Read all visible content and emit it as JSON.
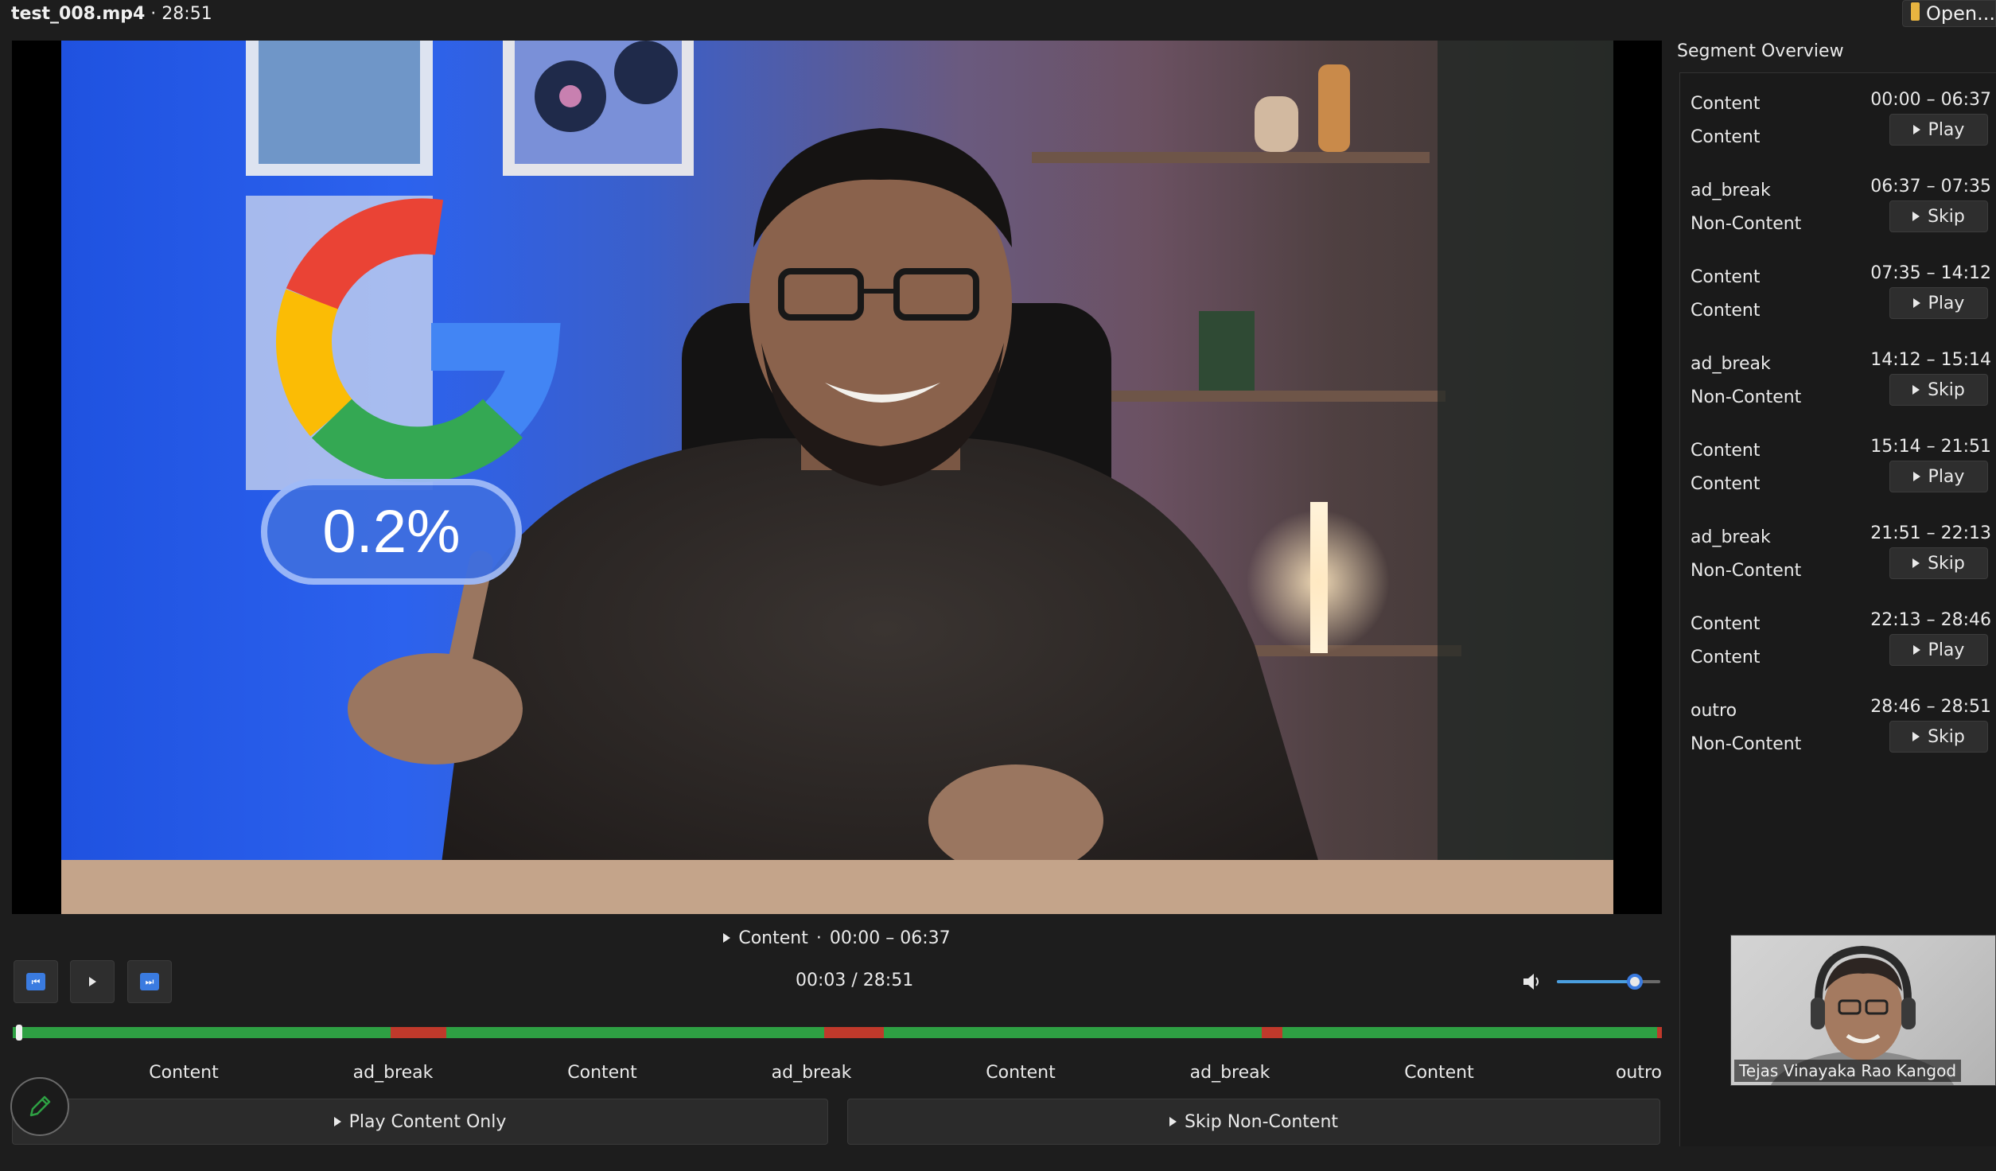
{
  "window": {
    "filename": "test_008.mp4",
    "separator": " · ",
    "duration": "28:51",
    "open_label": "Open..."
  },
  "icons": {
    "open": "folder-icon",
    "prev": "skip-back-icon",
    "play": "play-icon",
    "next": "skip-forward-icon",
    "volume": "speaker-icon",
    "edit": "pencil-icon"
  },
  "video": {
    "overlay_text": "0.2%"
  },
  "current_segment": {
    "label": "Content",
    "separator": "·",
    "range": "00:00 – 06:37"
  },
  "playback": {
    "time": "00:03 / 28:51",
    "position_fraction": 0.002,
    "volume_fraction": 0.75
  },
  "timeline": {
    "segments": [
      {
        "label": "Content",
        "start": "00:00",
        "end": "06:37",
        "color": "#2ea043"
      },
      {
        "label": "ad_break",
        "start": "06:37",
        "end": "07:35",
        "color": "#c0392b"
      },
      {
        "label": "Content",
        "start": "07:35",
        "end": "14:12",
        "color": "#2ea043"
      },
      {
        "label": "ad_break",
        "start": "14:12",
        "end": "15:14",
        "color": "#c0392b"
      },
      {
        "label": "Content",
        "start": "15:14",
        "end": "21:51",
        "color": "#2ea043"
      },
      {
        "label": "ad_break",
        "start": "21:51",
        "end": "22:13",
        "color": "#c0392b"
      },
      {
        "label": "Content",
        "start": "22:13",
        "end": "28:46",
        "color": "#2ea043"
      },
      {
        "label": "outro",
        "start": "28:46",
        "end": "28:51",
        "color": "#c0392b"
      }
    ]
  },
  "actions": {
    "play_content_only": "Play Content Only",
    "skip_non_content": "Skip Non-Content"
  },
  "panel": {
    "title": "Segment Overview",
    "rows": [
      {
        "label": "Content",
        "kind": "Content",
        "range": "00:00 – 06:37",
        "action": "Play"
      },
      {
        "label": "ad_break",
        "kind": "Non-Content",
        "range": "06:37 – 07:35",
        "action": "Skip"
      },
      {
        "label": "Content",
        "kind": "Content",
        "range": "07:35 – 14:12",
        "action": "Play"
      },
      {
        "label": "ad_break",
        "kind": "Non-Content",
        "range": "14:12 – 15:14",
        "action": "Skip"
      },
      {
        "label": "Content",
        "kind": "Content",
        "range": "15:14 – 21:51",
        "action": "Play"
      },
      {
        "label": "ad_break",
        "kind": "Non-Content",
        "range": "21:51 – 22:13",
        "action": "Skip"
      },
      {
        "label": "Content",
        "kind": "Content",
        "range": "22:13 – 28:46",
        "action": "Play"
      },
      {
        "label": "outro",
        "kind": "Non-Content",
        "range": "28:46 – 28:51",
        "action": "Skip"
      }
    ]
  },
  "webcam": {
    "name": "Tejas Vinayaka Rao Kangod"
  },
  "colors": {
    "content": "#2ea043",
    "non_content": "#c0392b",
    "accent": "#3a7be0"
  }
}
